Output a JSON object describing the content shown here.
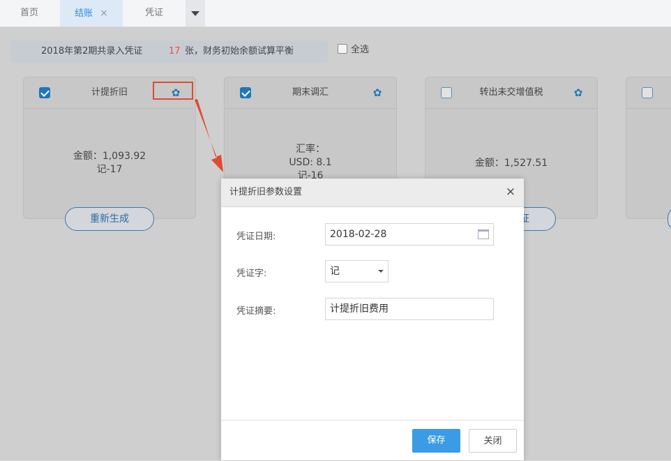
{
  "tabs": [
    {
      "label": "首页"
    },
    {
      "label": "结账",
      "close": "×"
    },
    {
      "label": "凭证"
    }
  ],
  "summary": {
    "prefix": "2018年第2期共录入凭证",
    "count": "17",
    "suffix": "张，财务初始余额试算平衡"
  },
  "select_all": {
    "label": "全选"
  },
  "cards": [
    {
      "title": "计提折旧",
      "line1": "金额：1,093.92",
      "line2": "记-17",
      "button": "重新生成"
    },
    {
      "title": "期末调汇",
      "line1": "汇率：",
      "line2": "USD: 8.1",
      "line3": "记-16"
    },
    {
      "title": "转出未交增值税",
      "line1": "金额：1,527.51",
      "button": "证"
    }
  ],
  "icons": {
    "gear": "gear-icon",
    "close": "close-icon",
    "calendar": "calendar-icon",
    "checkbox": "checkbox-icon"
  },
  "dialog": {
    "title": "计提折旧参数设置",
    "close": "×",
    "fields": {
      "date_label": "凭证日期:",
      "date_value": "2018-02-28",
      "word_label": "凭证字:",
      "word_value": "记",
      "summary_label": "凭证摘要:",
      "summary_value": "计提折旧费用"
    },
    "save": "保存",
    "close_button": "关闭"
  },
  "colors": {
    "accent": "#3b9be4",
    "highlight": "#e04a2f",
    "count": "#e5533d"
  }
}
